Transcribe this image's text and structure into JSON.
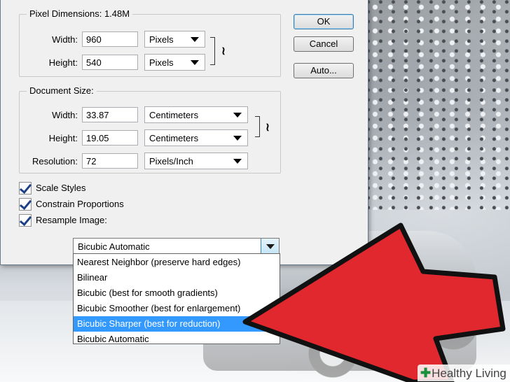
{
  "pixel_dimensions": {
    "title": "Pixel Dimensions:",
    "value": "1.48M",
    "width_label": "Width:",
    "width_value": "960",
    "width_unit": "Pixels",
    "height_label": "Height:",
    "height_value": "540",
    "height_unit": "Pixels"
  },
  "document_size": {
    "title": "Document Size:",
    "width_label": "Width:",
    "width_value": "33.87",
    "width_unit": "Centimeters",
    "height_label": "Height:",
    "height_value": "19.05",
    "height_unit": "Centimeters",
    "resolution_label": "Resolution:",
    "resolution_value": "72",
    "resolution_unit": "Pixels/Inch"
  },
  "checkboxes": [
    {
      "label": "Scale Styles",
      "checked": true
    },
    {
      "label": "Constrain Proportions",
      "checked": true
    },
    {
      "label": "Resample Image:",
      "checked": true
    }
  ],
  "buttons": {
    "ok": "OK",
    "cancel": "Cancel",
    "auto": "Auto..."
  },
  "resample": {
    "selected": "Bicubic Automatic",
    "options": [
      "Nearest Neighbor (preserve hard edges)",
      "Bilinear",
      "Bicubic (best for smooth gradients)",
      "Bicubic Smoother (best for enlargement)",
      "Bicubic Sharper (best for reduction)",
      "Bicubic Automatic"
    ],
    "highlighted_index": 4
  },
  "icons": {
    "link": "chain-link-icon",
    "dropdown": "chevron-down-icon",
    "pointer": "red-arrow-icon"
  },
  "colors": {
    "highlight": "#3399ff",
    "arrow": "#e0282e"
  },
  "watermark": {
    "text": "Healthy Living"
  }
}
